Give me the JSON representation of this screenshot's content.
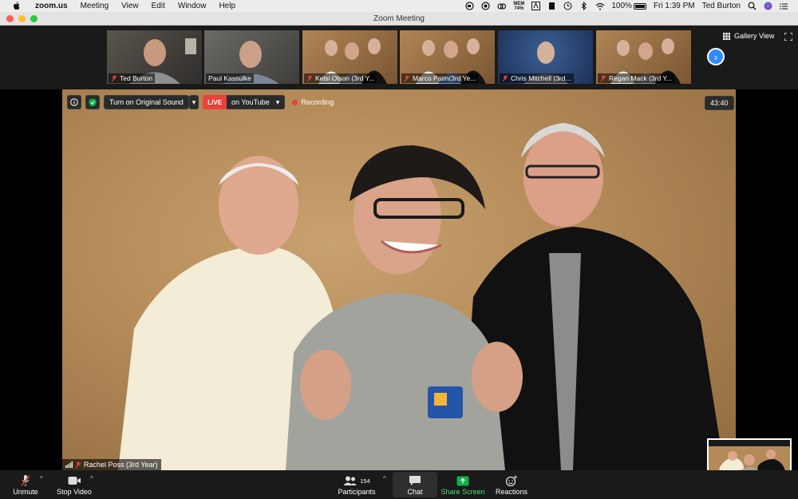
{
  "menubar": {
    "app_name": "zoom.us",
    "menus": [
      "Meeting",
      "View",
      "Edit",
      "Window",
      "Help"
    ],
    "memory_label": "MEM",
    "memory_value": "74%",
    "battery": "100%",
    "clock": "Fri 1:39 PM",
    "user": "Ted Burton"
  },
  "window": {
    "title": "Zoom Meeting"
  },
  "gallery": {
    "label": "Gallery View",
    "participants": [
      {
        "name": "Ted Burton"
      },
      {
        "name": "Paul Kassulke"
      },
      {
        "name": "Kelsi Olson (3rd Y..."
      },
      {
        "name": "Marco Paim(3rd Ye..."
      },
      {
        "name": "Chris Mitchell (3rd..."
      },
      {
        "name": "Regan Mack (3rd Y..."
      }
    ]
  },
  "video_toolbar": {
    "original_sound": "Turn on Original Sound",
    "live": "LIVE",
    "destination": "on YouTube",
    "recording": "Recording",
    "timer": "43:40"
  },
  "active_speaker": {
    "name": "Rachel Poss (3rd Year)"
  },
  "toolbar": {
    "unmute": "Unmute",
    "stop_video": "Stop Video",
    "participants": "Participants",
    "participant_count": "154",
    "chat": "Chat",
    "share_screen": "Share Screen",
    "reactions": "Reactions"
  },
  "colors": {
    "accent_blue": "#2d8cff",
    "live_red": "#e8423c",
    "share_green": "#0fb04a",
    "toolbar_bg": "#1a1a1a"
  }
}
